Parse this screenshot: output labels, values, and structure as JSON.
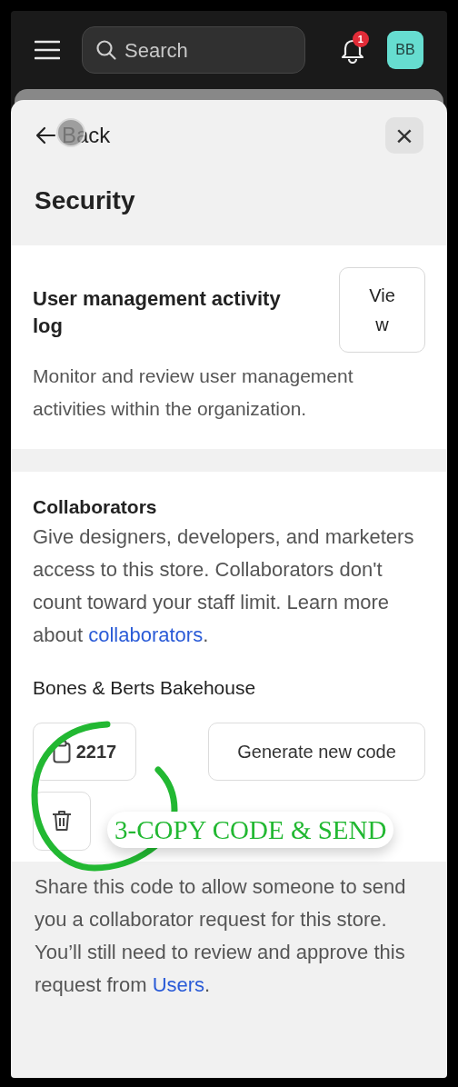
{
  "top_bar": {
    "search": {
      "placeholder": "Search"
    },
    "notification_count": "1",
    "avatar": "BB"
  },
  "sheet": {
    "back": "Back",
    "title": "Security",
    "close": "×"
  },
  "activity_log": {
    "title": "User management activity log",
    "button": "View",
    "description": "Monitor and review user management activities within the organization."
  },
  "collaborators": {
    "title": "Collaborators",
    "description": "Give designers, developers, and marketers access to this store. Collaborators don't count toward your staff limit. Learn more about",
    "link": "collaborators",
    "after_link": ".",
    "store_name": "Bones & Berts Bakehouse",
    "code": "2217",
    "generate_button": "Generate new code"
  },
  "footer": {
    "text": "Share this code to allow someone to send you a collaborator request for this store. You’ll still need to review and approve this request from",
    "link": "Users",
    "after_link": "."
  },
  "annotation": {
    "text": "3-COPY CODE & SEND"
  }
}
